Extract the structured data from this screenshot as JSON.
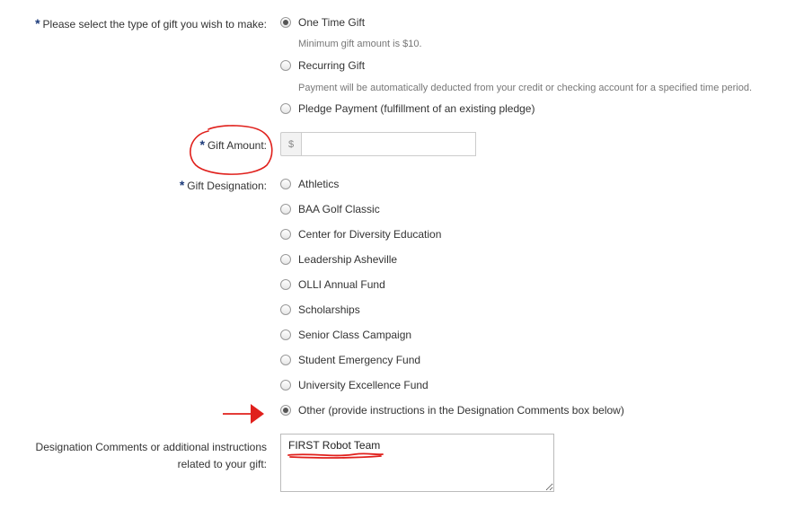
{
  "gift_type": {
    "label": "Please select the type of gift you wish to make:",
    "required_mark": "*",
    "options": [
      {
        "label": "One Time Gift",
        "checked": true,
        "help": "Minimum gift amount is $10."
      },
      {
        "label": "Recurring Gift",
        "checked": false,
        "help": "Payment will be automatically deducted from your credit or checking account for a specified time period."
      },
      {
        "label": "Pledge Payment (fulfillment of an existing pledge)",
        "checked": false,
        "help": ""
      }
    ]
  },
  "gift_amount": {
    "label": "Gift Amount:",
    "required_mark": "*",
    "currency_symbol": "$",
    "value": ""
  },
  "gift_designation": {
    "label": "Gift Designation:",
    "required_mark": "*",
    "options": [
      {
        "label": "Athletics",
        "checked": false
      },
      {
        "label": "BAA Golf Classic",
        "checked": false
      },
      {
        "label": "Center for Diversity Education",
        "checked": false
      },
      {
        "label": "Leadership Asheville",
        "checked": false
      },
      {
        "label": "OLLI Annual Fund",
        "checked": false
      },
      {
        "label": "Scholarships",
        "checked": false
      },
      {
        "label": "Senior Class Campaign",
        "checked": false
      },
      {
        "label": "Student Emergency Fund",
        "checked": false
      },
      {
        "label": "University Excellence Fund",
        "checked": false
      },
      {
        "label": "Other (provide instructions in the Designation Comments box below)",
        "checked": true
      }
    ]
  },
  "designation_comments": {
    "label_line1": "Designation Comments or additional instructions",
    "label_line2": "related to your gift:",
    "value": "FIRST Robot Team"
  },
  "annotation_color": "#e0201c"
}
